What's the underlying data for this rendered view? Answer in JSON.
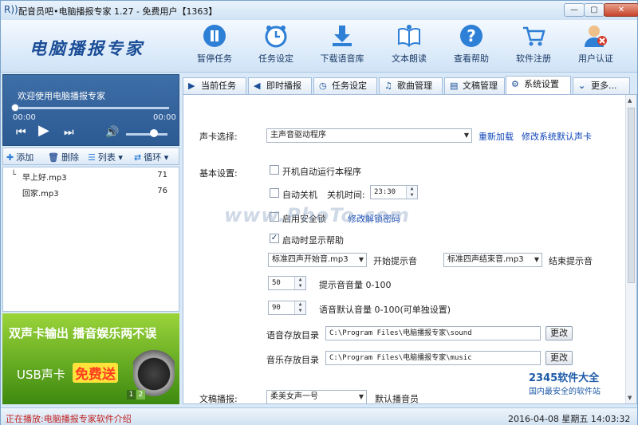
{
  "window": {
    "title": "配音员吧•电脑播报专家 1.27 - 免费用户【1363】",
    "min": "—",
    "max": "▢",
    "close": "✕"
  },
  "logo": "电脑播报专家",
  "toolbar": [
    {
      "label": "暂停任务",
      "icon": "pause-icon",
      "color": "#2e7fd6"
    },
    {
      "label": "任务设定",
      "icon": "alarm-clock-icon",
      "color": "#2e7fd6"
    },
    {
      "label": "下载语音库",
      "icon": "download-icon",
      "color": "#2e7fd6"
    },
    {
      "label": "文本朗读",
      "icon": "open-book-icon",
      "color": "#2e7fd6"
    },
    {
      "label": "查看帮助",
      "icon": "help-icon",
      "color": "#2e7fd6"
    },
    {
      "label": "软件注册",
      "icon": "cart-icon",
      "color": "#2e7fd6"
    },
    {
      "label": "用户认证",
      "icon": "user-icon",
      "color": "#2e7fd6"
    }
  ],
  "player": {
    "welcome": "欢迎使用电脑播报专家",
    "time_elapsed": "00:00",
    "time_total": "00:00",
    "progress": 0,
    "volume": 0.7
  },
  "playlist_toolbar": {
    "add": "添加",
    "delete": "删除",
    "list": "列表",
    "loop": "循环"
  },
  "playlist": [
    {
      "name": "早上好.mp3",
      "count": "71"
    },
    {
      "name": "回家.mp3",
      "count": "76"
    }
  ],
  "ad": {
    "line1": "双声卡输出 播音娱乐两不误",
    "line2": "USB声卡",
    "highlight": "免费送",
    "page1": "1",
    "page2": "2"
  },
  "tabs": [
    {
      "label": "当前任务",
      "icon": "play-icon"
    },
    {
      "label": "即时播报",
      "icon": "speaker-icon"
    },
    {
      "label": "任务设定",
      "icon": "clock-icon"
    },
    {
      "label": "歌曲管理",
      "icon": "music-icon"
    },
    {
      "label": "文稿管理",
      "icon": "document-icon"
    },
    {
      "label": "系统设置",
      "icon": "gear-icon"
    },
    {
      "label": "更多...",
      "icon": "chevron-down-icon"
    }
  ],
  "settings": {
    "soundcard_label": "声卡选择:",
    "soundcard_value": "主声音驱动程序",
    "reload": "重新加载",
    "modify_default": "修改系统默认声卡",
    "basic_label": "基本设置:",
    "autostart": {
      "label": "开机自动运行本程序",
      "checked": false
    },
    "autoshutdown": {
      "label": "自动关机",
      "checked": false
    },
    "shutdown_time_label": "关机时间:",
    "shutdown_time": "23:30",
    "security_lock": {
      "label": "启用安全锁",
      "checked": false
    },
    "modify_password": "修改解锁密码",
    "show_help": {
      "label": "启动时显示帮助",
      "checked": true
    },
    "start_sound": "标准四声开始音.mp3",
    "start_sound_label": "开始提示音",
    "end_sound": "标准四声结束音.mp3",
    "end_sound_label": "结束提示音",
    "prompt_volume": "50",
    "prompt_volume_label": "提示音音量 0-100",
    "voice_volume": "90",
    "voice_volume_label": "语音默认音量 0-100(可单独设置)",
    "voice_dir_label": "语音存放目录",
    "voice_dir": "C:\\Program Files\\电脑播报专家\\sound",
    "music_dir_label": "音乐存放目录",
    "music_dir": "C:\\Program Files\\电脑播报专家\\music",
    "change": "更改",
    "doc_label": "文稿播报:",
    "doc_voice": "柔美女声一号",
    "doc_voice_label": "默认播音员"
  },
  "watermark": "www.PhoTo.com",
  "brand": {
    "name": "2345软件大全",
    "slogan": "国内最安全的软件站"
  },
  "status": {
    "playing": "正在播放:电脑播报专家软件介绍",
    "datetime": "2016-04-08 星期五 14:03:32"
  }
}
